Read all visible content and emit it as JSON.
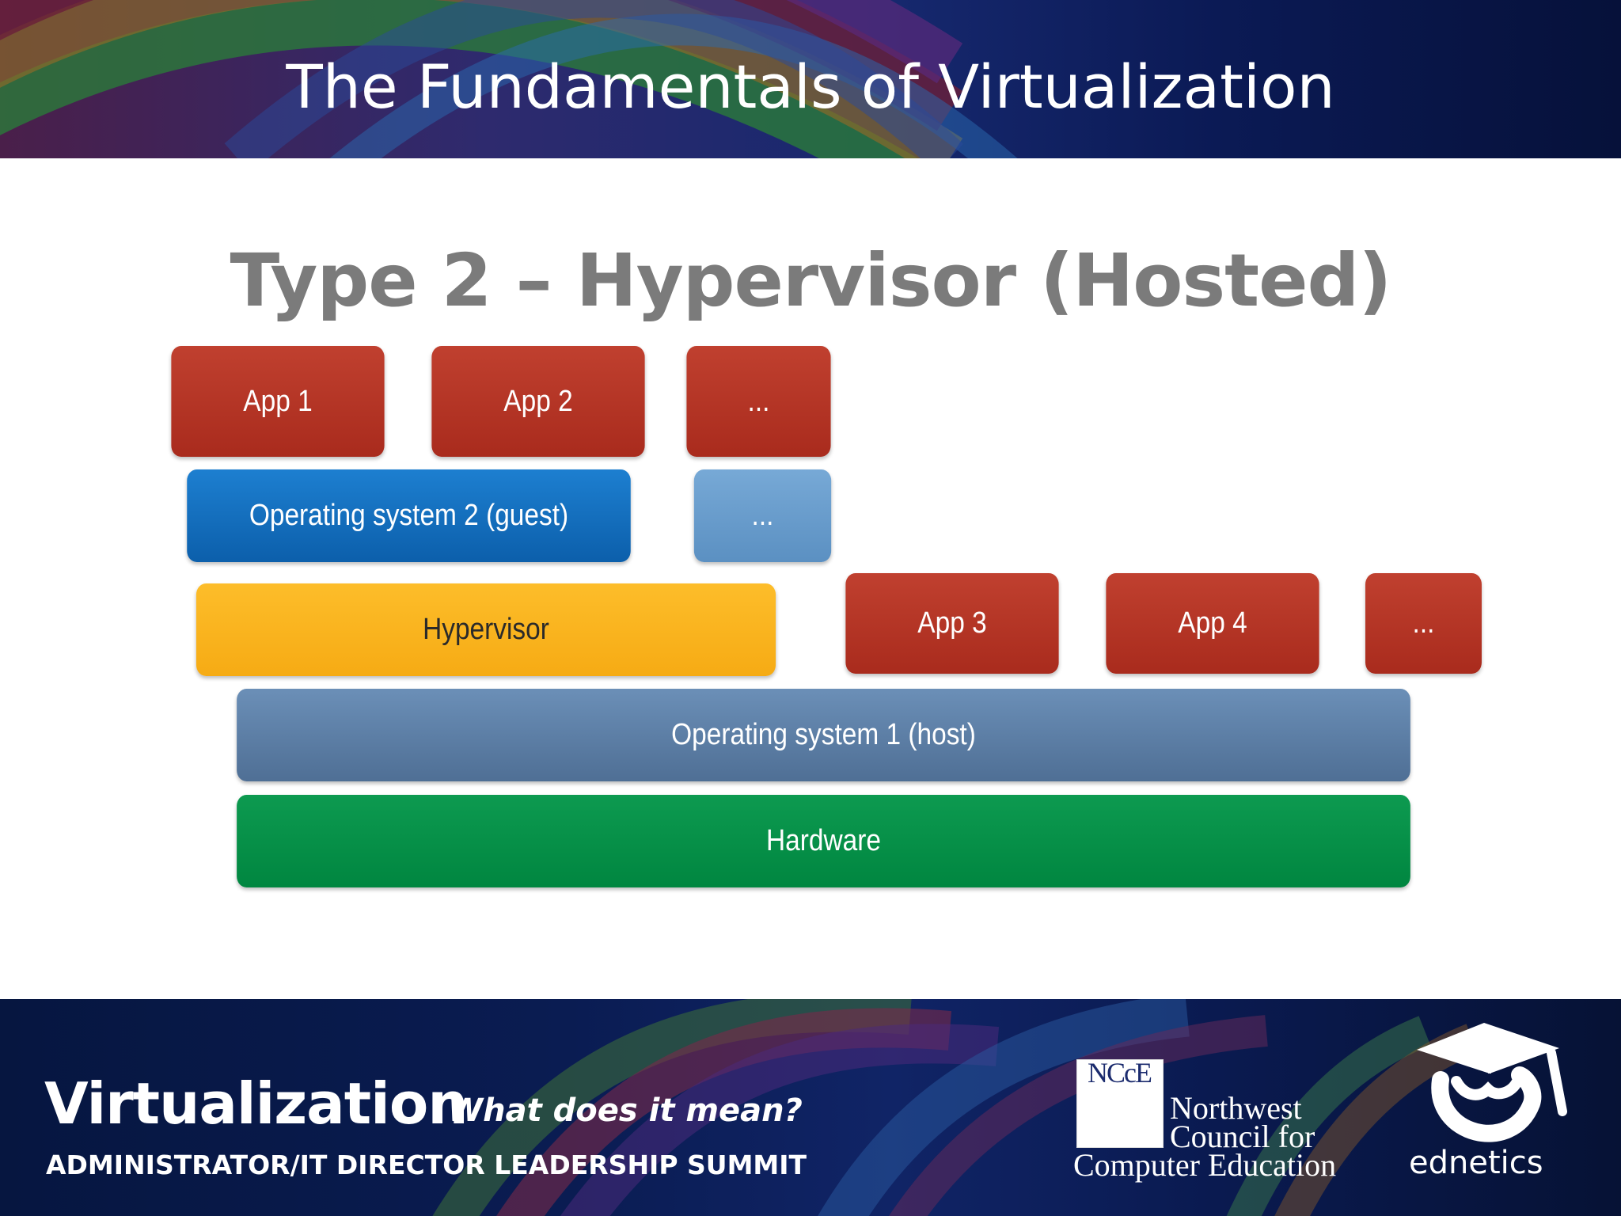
{
  "header": {
    "title": "The Fundamentals of Virtualization"
  },
  "slide": {
    "title": "Type 2 – Hypervisor (Hosted)"
  },
  "diagram": {
    "layers": {
      "apps_guest": [
        "App 1",
        "App 2",
        "..."
      ],
      "guest_os": {
        "label": "Operating system 2 (guest)",
        "more": "..."
      },
      "hypervisor": "Hypervisor",
      "apps_host": [
        "App 3",
        "App 4",
        "..."
      ],
      "host_os": "Operating system 1 (host)",
      "hardware": "Hardware"
    },
    "colors": {
      "app": "#b0321f",
      "guest_os": "#1170bf",
      "guest_more": "#6a9ecc",
      "hypervisor": "#f9b31c",
      "host_os": "#5d7fa6",
      "hardware": "#00904a"
    }
  },
  "footer": {
    "event_title": "Virtualization",
    "event_tagline": "What does it mean?",
    "event_subtitle": "ADMINISTRATOR/IT DIRECTOR LEADERSHIP SUMMIT",
    "ncce": {
      "mark": "NCcE",
      "line1": "Northwest",
      "line2": "Council for",
      "line3": "Computer Education"
    },
    "ednetics": "ednetics"
  }
}
